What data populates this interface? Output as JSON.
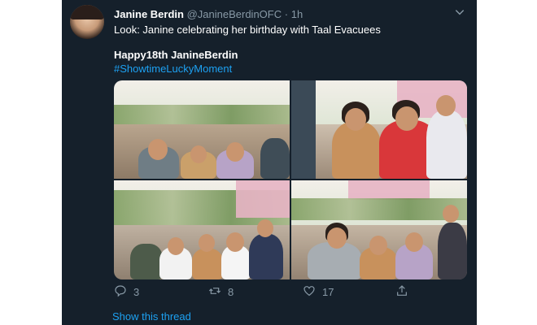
{
  "tweet": {
    "author_name": "Janine Berdin",
    "handle": "@JanineBerdinOFC",
    "separator": "·",
    "time": "1h",
    "text_line1": "Look: Janine celebrating her birthday with Taal Evacuees",
    "text_line2": "Happy18th JanineBerdin",
    "hashtag": "#ShowtimeLuckyMoment",
    "photo_count": 4
  },
  "actions": {
    "reply_count": "3",
    "retweet_count": "8",
    "like_count": "17"
  },
  "icons": [
    "chevron-down-icon",
    "reply-icon",
    "retweet-icon",
    "like-icon",
    "share-icon"
  ],
  "thread_link": "Show this thread",
  "colors": {
    "background": "#15202b",
    "text": "#ffffff",
    "muted": "#8899a6",
    "link": "#1da1f2"
  }
}
